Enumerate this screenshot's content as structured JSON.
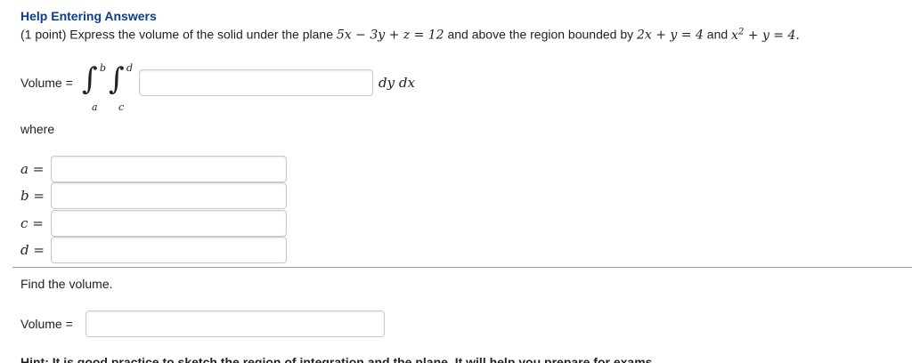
{
  "header": {
    "help_link": "Help Entering Answers"
  },
  "problem": {
    "points": "(1 point)",
    "text_a": "Express the volume of the solid under the plane",
    "plane": "5x − 3y + z = 12",
    "text_b": "and above the region bounded by",
    "curve1": "2x + y = 4",
    "text_c": "and",
    "curve2_base": "x",
    "curve2_exp": "2",
    "curve2_rest": "+ y = 4."
  },
  "integral": {
    "volume_label": "Volume =",
    "outer_upper": "b",
    "outer_lower": "a",
    "inner_upper": "d",
    "inner_lower": "c",
    "integrand": "",
    "differentials": "dy dx"
  },
  "where_label": "where",
  "limits": [
    {
      "var": "a",
      "eq": "=",
      "value": ""
    },
    {
      "var": "b",
      "eq": "=",
      "value": ""
    },
    {
      "var": "c",
      "eq": "=",
      "value": ""
    },
    {
      "var": "d",
      "eq": "=",
      "value": ""
    }
  ],
  "find_volume": {
    "prompt": "Find the volume.",
    "label": "Volume =",
    "value": ""
  },
  "hint_partial": "Hint: It is good practice to sketch the region of integration and the plane. It will help you prepare for exams."
}
